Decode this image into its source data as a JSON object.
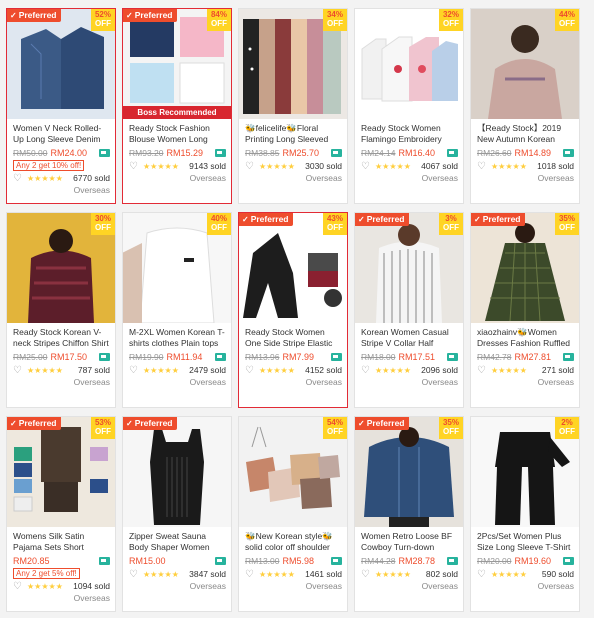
{
  "labels": {
    "preferred": "Preferred",
    "off": "OFF",
    "stars": "★★★★★",
    "heart": "♡",
    "check": "✓"
  },
  "products": [
    {
      "title": "Women V Neck Rolled-Up Long Sleeve Denim Tops Blouse",
      "old_price": "RM50.00",
      "price": "RM24.00",
      "discount": "52%",
      "promo": "Any 2 get 10% off!",
      "sold": "6770 sold",
      "location": "Overseas",
      "preferred": true,
      "highlight": true
    },
    {
      "title": "Ready Stock Fashion Blouse Women Long Sleeve Shirt",
      "old_price": "RM93.20",
      "price": "RM15.29",
      "discount": "84%",
      "banner": "Boss Recommended",
      "sold": "9143 sold",
      "location": "Overseas",
      "preferred": true,
      "highlight": true
    },
    {
      "title": "🐝felicelife🐝Floral Printing Long Sleeved Dress",
      "old_price": "RM38.85",
      "price": "RM25.70",
      "discount": "34%",
      "sold": "3030 sold",
      "location": "Overseas",
      "preferred": false,
      "highlight": false
    },
    {
      "title": "Ready Stock Women Flamingo Embroidery Hoodie",
      "old_price": "RM24.14",
      "price": "RM16.40",
      "discount": "32%",
      "sold": "4067 sold",
      "location": "Overseas",
      "preferred": false,
      "highlight": false
    },
    {
      "title": "【Ready Stock】2019 New Autumn Korean Sweater",
      "old_price": "RM26.60",
      "price": "RM14.89",
      "discount": "44%",
      "sold": "1018 sold",
      "location": "Overseas",
      "preferred": false,
      "highlight": false
    },
    {
      "title": "Ready Stock Korean V-neck Stripes Chiffon Shirt",
      "old_price": "RM25.00",
      "price": "RM17.50",
      "discount": "30%",
      "sold": "787 sold",
      "location": "Overseas",
      "preferred": false,
      "highlight": false
    },
    {
      "title": "M-2XL Women Korean T-shirts clothes Plain tops",
      "old_price": "RM19.90",
      "price": "RM11.94",
      "discount": "40%",
      "sold": "2479 sold",
      "location": "Overseas",
      "preferred": false,
      "highlight": false
    },
    {
      "title": "Ready Stock Women One Side Stripe Elastic Waist Pants",
      "old_price": "RM13.96",
      "price": "RM7.99",
      "discount": "43%",
      "sold": "4152 sold",
      "location": "Overseas",
      "preferred": true,
      "highlight": true
    },
    {
      "title": "Korean Women Casual Stripe V Collar Half Sleeve Shirt",
      "old_price": "RM18.00",
      "price": "RM17.51",
      "discount": "3%",
      "sold": "2096 sold",
      "location": "Overseas",
      "preferred": true,
      "highlight": false
    },
    {
      "title": "xiaozhainv🐝Women Dresses Fashion Ruffled Plaid",
      "old_price": "RM42.78",
      "price": "RM27.81",
      "discount": "35%",
      "sold": "271 sold",
      "location": "Overseas",
      "preferred": true,
      "highlight": false
    },
    {
      "title": "Womens Silk Satin Pajama Sets Short Sleeve Sleepwear",
      "old_price": "",
      "price": "RM20.85",
      "discount": "53%",
      "promo": "Any 2 get 5% off!",
      "sold": "1094 sold",
      "location": "Overseas",
      "preferred": true,
      "highlight": false
    },
    {
      "title": "Zipper Sweat Sauna Body Shaper Women Slimming Vest",
      "old_price": "",
      "price": "RM15.00",
      "discount": "",
      "sold": "3847 sold",
      "location": "Overseas",
      "preferred": true,
      "highlight": false
    },
    {
      "title": "🐝New Korean style🐝solid color off shoulder tops",
      "old_price": "RM13.00",
      "price": "RM5.98",
      "discount": "54%",
      "sold": "1461 sold",
      "location": "Overseas",
      "preferred": false,
      "highlight": false
    },
    {
      "title": "Women Retro Loose BF Cowboy Turn-down Collar Jacket",
      "old_price": "RM44.28",
      "price": "RM28.78",
      "discount": "35%",
      "sold": "802 sold",
      "location": "Overseas",
      "preferred": true,
      "highlight": false
    },
    {
      "title": "2Pcs/Set Women Plus Size Long Sleeve T-Shirt Pants",
      "old_price": "RM20.00",
      "price": "RM19.60",
      "discount": "2%",
      "sold": "590 sold",
      "location": "Overseas",
      "preferred": false,
      "highlight": false
    }
  ]
}
